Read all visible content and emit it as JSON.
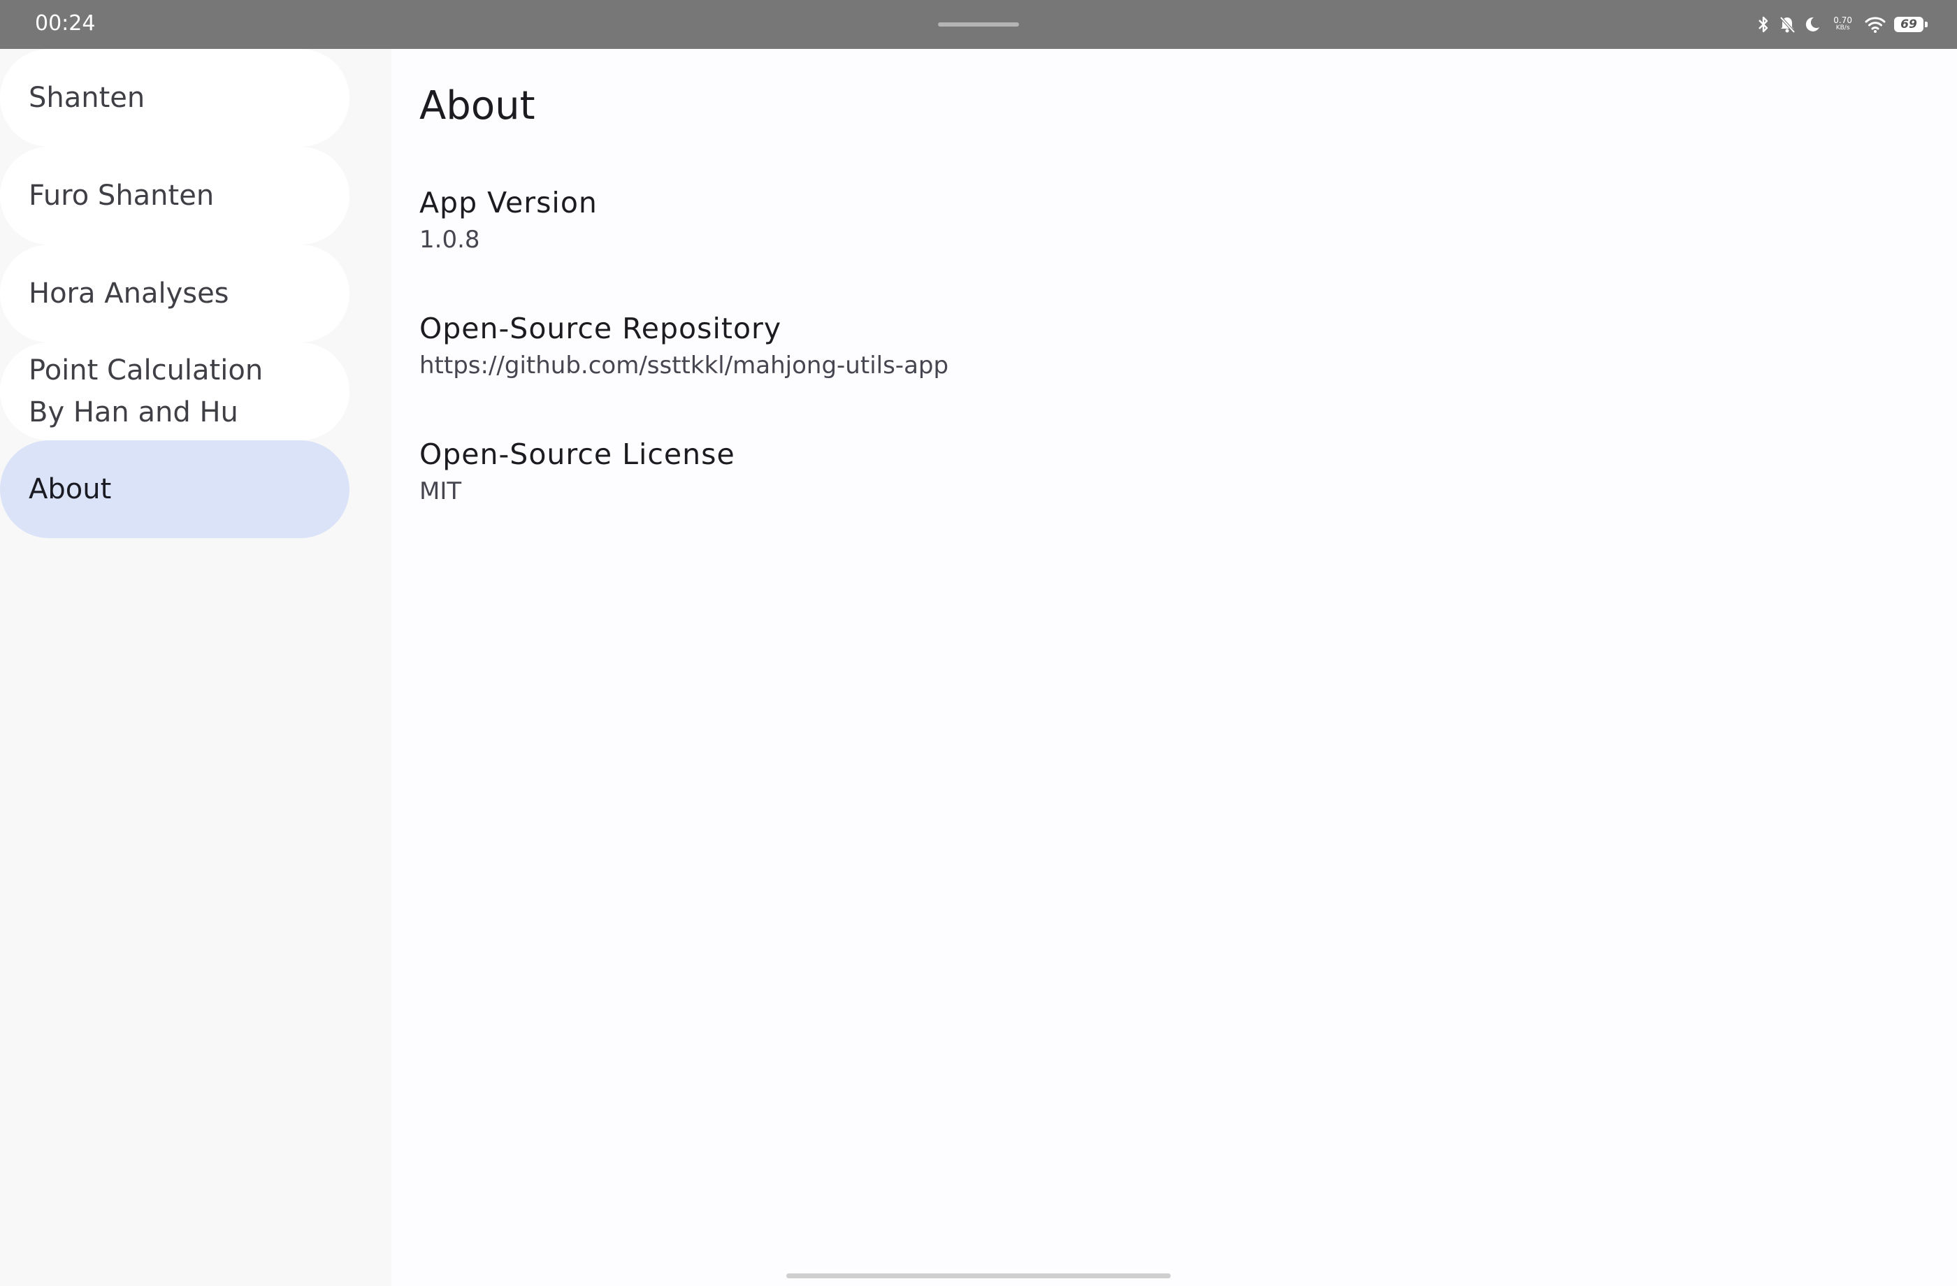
{
  "status_bar": {
    "time": "00:24",
    "net_speed_value": "0.70",
    "net_speed_unit": "KB/s",
    "battery_level": "69",
    "icons": [
      "bluetooth-icon",
      "mute-bell-icon",
      "moon-icon",
      "wifi-icon",
      "battery-icon"
    ]
  },
  "nav": {
    "items": [
      {
        "label": "Shanten",
        "active": false
      },
      {
        "label": "Furo Shanten",
        "active": false
      },
      {
        "label": "Hora Analyses",
        "active": false
      },
      {
        "label": "Point Calculation\nBy Han and Hu",
        "active": false
      },
      {
        "label": "About",
        "active": true
      }
    ]
  },
  "main": {
    "title": "About",
    "items": [
      {
        "label": "App Version",
        "value": "1.0.8"
      },
      {
        "label": "Open-Source Repository",
        "value": "https://github.com/ssttkkl/mahjong-utils-app"
      },
      {
        "label": "Open-Source License",
        "value": "MIT"
      }
    ]
  },
  "colors": {
    "status_bar_bg": "#777777",
    "nav_bg": "#f8f8f8",
    "nav_active_bg": "#dae3f7",
    "content_bg": "#fdfcfe"
  }
}
